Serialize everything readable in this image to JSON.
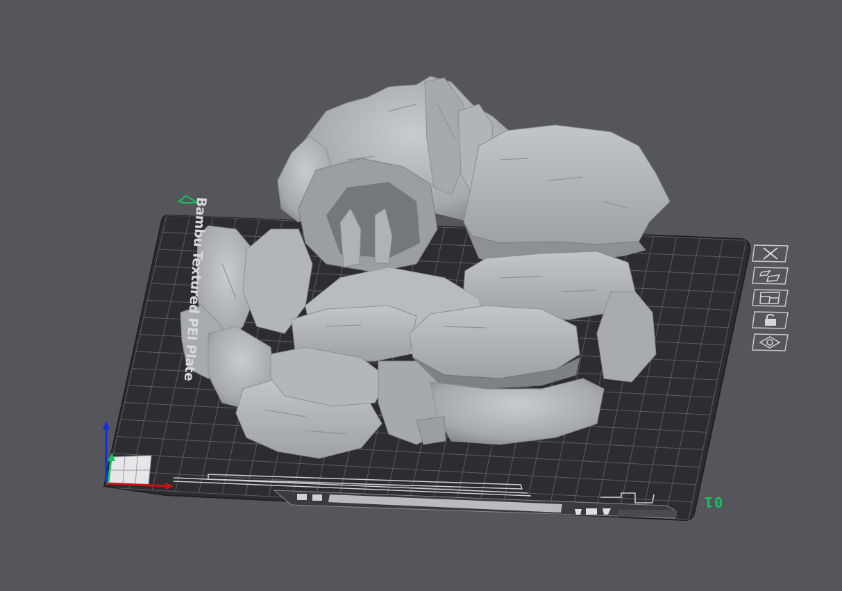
{
  "viewport": {
    "background": "#55555c",
    "plate_name": "Bambu Textured PEI Plate",
    "plate_number": "01",
    "model": "rocky cave terrain model"
  },
  "plate_tools": [
    {
      "name": "close-icon",
      "label": "Delete plate"
    },
    {
      "name": "auto-arrange-icon",
      "label": "Arrange"
    },
    {
      "name": "auto-orient-icon",
      "label": "Orient"
    },
    {
      "name": "lock-icon",
      "label": "Lock plate"
    },
    {
      "name": "eye-icon",
      "label": "Plate settings"
    }
  ],
  "colors": {
    "bed": "#2c2c31",
    "grid": "#5a5a62",
    "model": "#b9bcbf",
    "accent": "#19c15a",
    "axis_x": "#d01010",
    "axis_y": "#19c15a",
    "axis_z": "#1030e0"
  }
}
